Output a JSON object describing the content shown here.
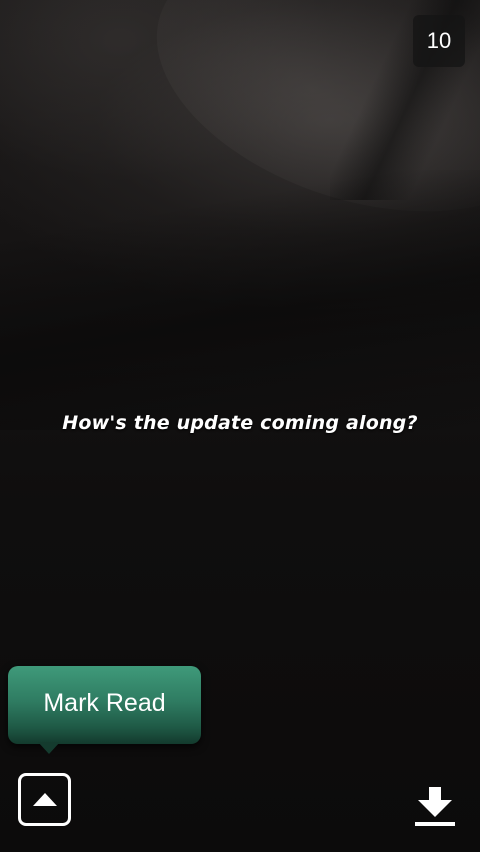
{
  "snap": {
    "timer_seconds": "10",
    "caption": "How's the update coming along?"
  },
  "actions": {
    "mark_read_label": "Mark Read",
    "expand_icon": "chevron-up-icon",
    "download_icon": "download-icon"
  },
  "colors": {
    "mark_read_button": "#2f7c62",
    "text": "#ffffff",
    "badge_background": "#141414"
  }
}
